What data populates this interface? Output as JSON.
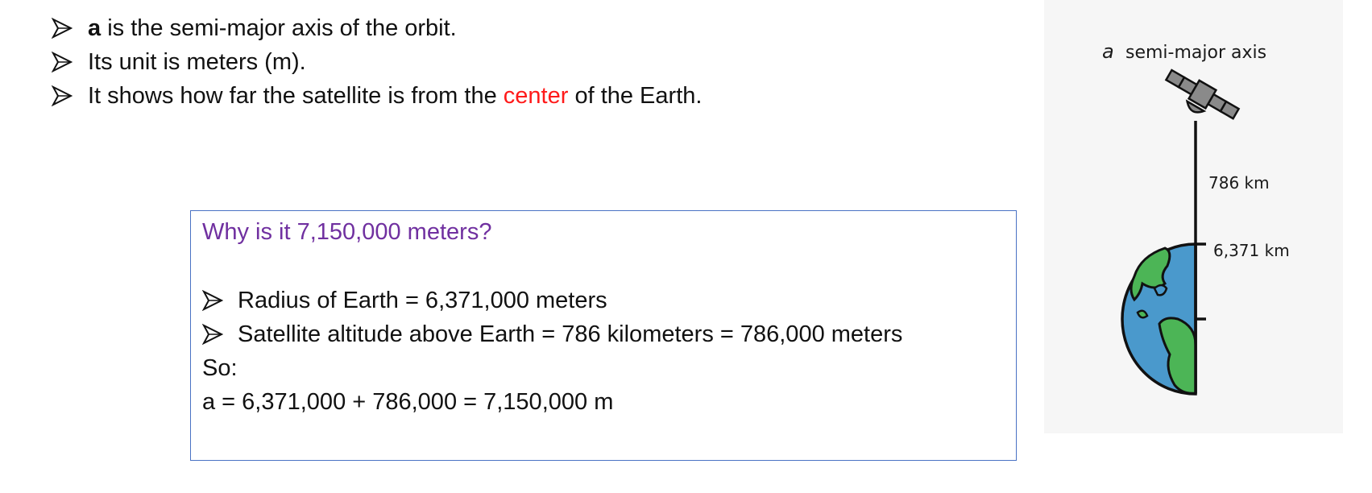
{
  "bullets": [
    {
      "bold": "a",
      "text": " is the semi-major axis of the orbit."
    },
    {
      "text": "Its unit is meters (m)."
    },
    {
      "before": "It shows how far the satellite is from the ",
      "highlight": "center",
      "after": " of the Earth."
    }
  ],
  "box": {
    "title": "Why is it 7,150,000 meters?",
    "items": [
      "Radius of Earth = 6,371,000 meters",
      "Satellite altitude above Earth = 786 kilometers = 786,000 meters"
    ],
    "so": "So:",
    "equation": "a = 6,371,000 + 786,000 = 7,150,000 m"
  },
  "diagram": {
    "symbol": "a",
    "label": "semi-major axis",
    "altitude": "786 km",
    "radius": "6,371 km"
  },
  "colors": {
    "highlight": "#ff1a1a",
    "box_title": "#7030a0",
    "box_border": "#4a72c4",
    "ocean": "#4a99cc",
    "land": "#4cb556"
  },
  "icons": [
    "arrow-bullet-icon",
    "satellite-icon",
    "earth-icon"
  ]
}
